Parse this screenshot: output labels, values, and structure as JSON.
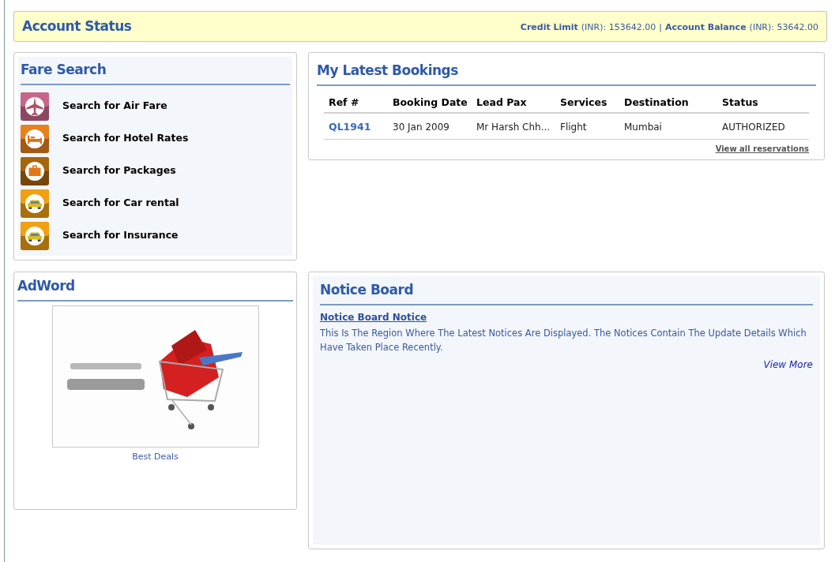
{
  "account_status": {
    "title": "Account Status",
    "credit_label": "Credit Limit",
    "credit_unit": "(INR): 153642.00",
    "separator": "|",
    "balance_label": "Account Balance",
    "balance_unit": "(INR): 53642.00"
  },
  "fare_search": {
    "title": "Fare Search",
    "items": [
      {
        "label": "Search for Air Fare",
        "kind": "plane",
        "color": "#c8668a"
      },
      {
        "label": "Search for Hotel Rates",
        "kind": "bed",
        "color": "#e8801c"
      },
      {
        "label": "Search for Packages",
        "kind": "suitcase",
        "color": "#a8660c"
      },
      {
        "label": "Search for Car rental",
        "kind": "car",
        "color": "#f0a012"
      },
      {
        "label": "Search for Insurance",
        "kind": "car",
        "color": "#f0a012"
      }
    ]
  },
  "bookings": {
    "title": "My Latest Bookings",
    "columns": [
      "Ref #",
      "Booking Date",
      "Lead Pax",
      "Services",
      "Destination",
      "Status"
    ],
    "rows": [
      [
        "QL1941",
        "30 Jan 2009",
        "Mr Harsh Chh...",
        "Flight",
        "Mumbai",
        "AUTHORIZED"
      ]
    ],
    "view_all": "View all reservations"
  },
  "adword": {
    "title": "AdWord",
    "caption": "Best Deals"
  },
  "notice_board": {
    "title": "Notice Board",
    "notice_title": "Notice Board Notice",
    "notice_text": "This Is The Region Where The Latest Notices Are Displayed. The Notices Contain The Update Details Which Have Taken Place Recently.",
    "view_more": "View More"
  }
}
